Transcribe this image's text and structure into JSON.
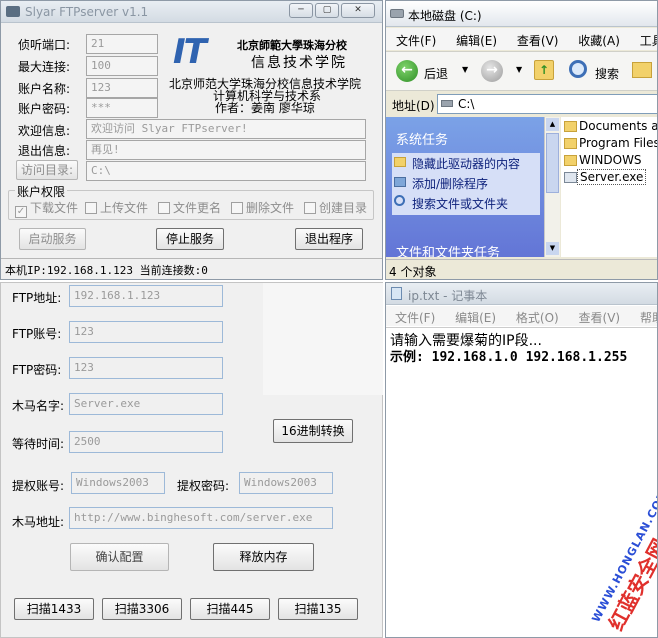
{
  "ftpserver": {
    "title": "Slyar FTPserver v1.1",
    "fields": [
      {
        "label": "侦听端口:",
        "value": "21"
      },
      {
        "label": "最大连接:",
        "value": "100"
      },
      {
        "label": "账户名称:",
        "value": "123"
      },
      {
        "label": "账户密码:",
        "value": "***"
      }
    ],
    "welcome_label": "欢迎信息:",
    "welcome_value": "欢迎访问 Slyar FTPserver!",
    "exit_label": "退出信息:",
    "exit_value": "再见!",
    "dir_button": "访问目录:",
    "dir_value": "C:\\",
    "logo_text": "IT",
    "logo_school": "北京師範大學珠海分校",
    "logo_dept": "信息技术学院",
    "college_line1": "北京师范大学珠海分校信息技术学院",
    "college_line2": "计算机科学与技术系",
    "author": "作者：姜南 廖华琼",
    "perm_title": "账户权限",
    "perms": [
      "下载文件",
      "上传文件",
      "文件更名",
      "删除文件",
      "创建目录"
    ],
    "start_button": "启动服务",
    "stop_button": "停止服务",
    "exit_button": "退出程序",
    "status": "本机IP:192.168.1.123 当前连接数:0"
  },
  "explorer": {
    "title": "本地磁盘 (C:)",
    "menu": [
      "文件(F)",
      "编辑(E)",
      "查看(V)",
      "收藏(A)",
      "工具(T)"
    ],
    "back_label": "后退",
    "search_label": "搜索",
    "address_label": "地址(D)",
    "address_value": "C:\\",
    "tasks_title": "系统任务",
    "tasks": [
      "隐藏此驱动器的内容",
      "添加/删除程序",
      "搜索文件或文件夹"
    ],
    "tasks_title2": "文件和文件夹任务",
    "files": [
      "Documents and",
      "Program Files",
      "WINDOWS",
      "Server.exe"
    ],
    "status": "4 个对象"
  },
  "trojan": {
    "ftp_addr_label": "FTP地址:",
    "ftp_addr_value": "192.168.1.123",
    "ftp_user_label": "FTP账号:",
    "ftp_user_value": "123",
    "ftp_pass_label": "FTP密码:",
    "ftp_pass_value": "123",
    "name_label": "木马名字:",
    "name_value": "Server.exe",
    "wait_label": "等待时间:",
    "wait_value": "2500",
    "hex_button": "16进制转换",
    "priv_user_label": "提权账号:",
    "priv_user_value": "Windows2003",
    "priv_pass_label": "提权密码:",
    "priv_pass_value": "Windows2003",
    "url_label": "木马地址:",
    "url_value": "http://www.binghesoft.com/server.exe",
    "confirm_button": "确认配置",
    "release_button": "释放内存",
    "scan_buttons": [
      "扫描1433",
      "扫描3306",
      "扫描445",
      "扫描135"
    ]
  },
  "notepad": {
    "title": "ip.txt - 记事本",
    "menu": [
      "文件(F)",
      "编辑(E)",
      "格式(O)",
      "查看(V)",
      "帮助(H)"
    ],
    "line1": "请输入需要爆菊的IP段...",
    "line2": "示例: 192.168.1.0 192.168.1.255"
  },
  "watermark": {
    "text": "红蓝安全网",
    "url": "WWW.HONGLAN.COM"
  }
}
